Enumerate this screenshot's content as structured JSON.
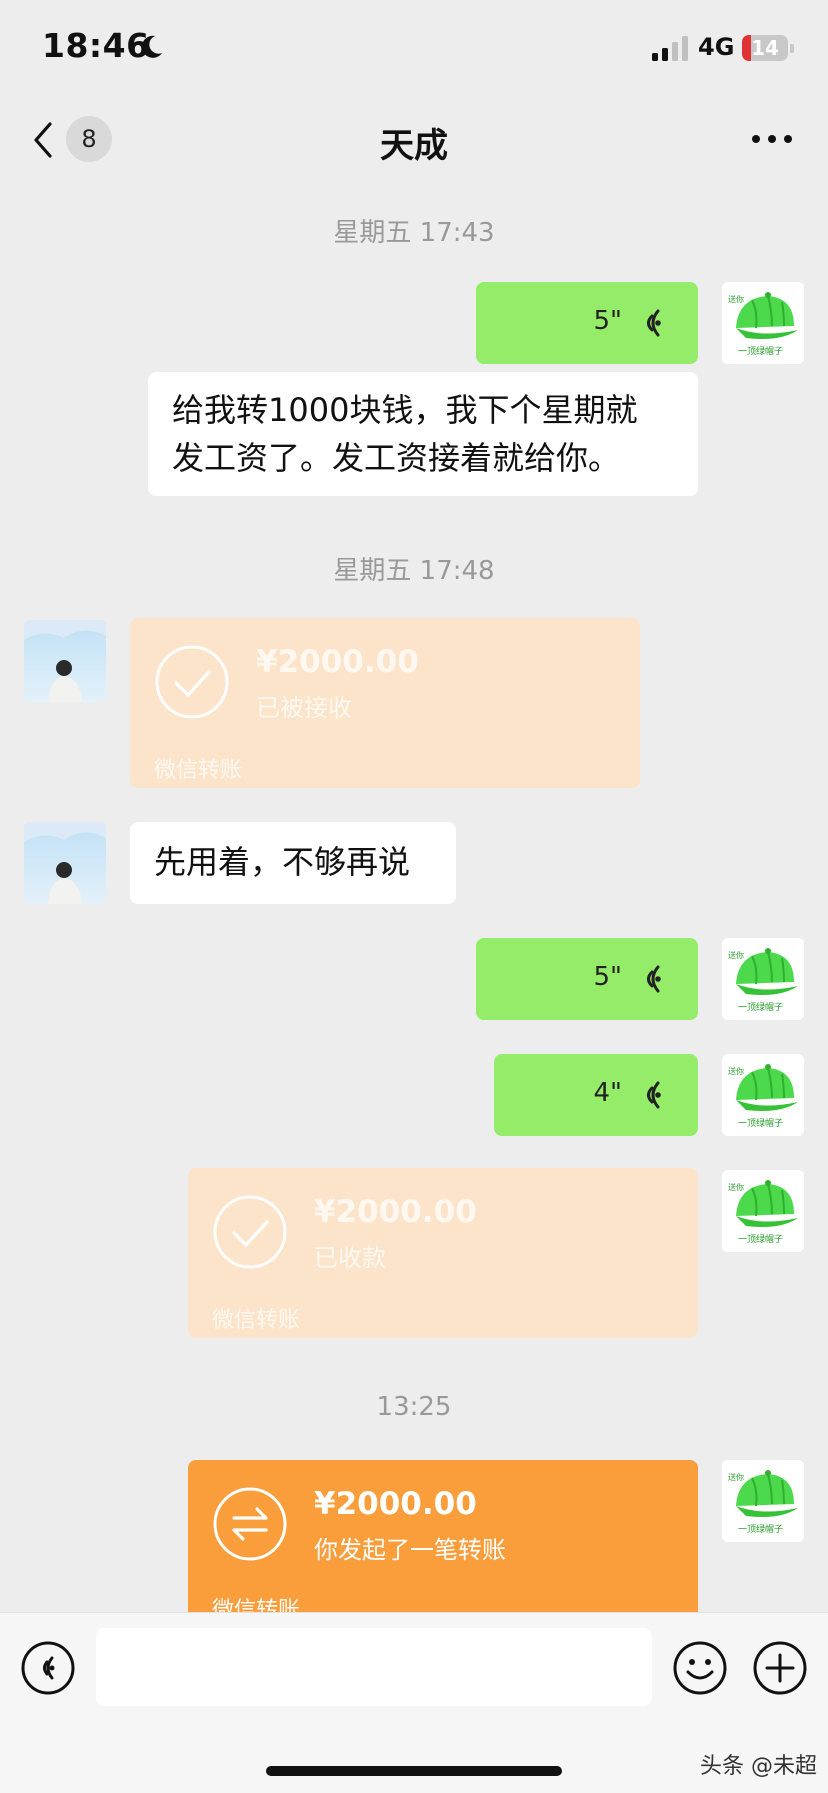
{
  "status_bar": {
    "time": "18:46",
    "network": "4G",
    "battery": "14"
  },
  "nav": {
    "unread_count": "8",
    "title": "天成"
  },
  "timestamps": [
    "星期五 17:43",
    "星期五 17:48",
    "13:25"
  ],
  "hat_sticker": {
    "top_text": "送你",
    "bottom_text": "一顶绿帽子"
  },
  "messages": {
    "voice_1": {
      "duration": "5\""
    },
    "text_1": {
      "line1": "给我转1000块钱，我下个星期就",
      "line2": "发工资了。发工资接着就给你。"
    },
    "transfer_1": {
      "amount": "¥2000.00",
      "status": "已被接收",
      "brand": "微信转账"
    },
    "text_2": {
      "content": "先用着，不够再说"
    },
    "voice_2": {
      "duration": "5\""
    },
    "voice_3": {
      "duration": "4\""
    },
    "transfer_2": {
      "amount": "¥2000.00",
      "status": "已收款",
      "brand": "微信转账"
    },
    "transfer_3": {
      "amount": "¥2000.00",
      "status": "你发起了一笔转账",
      "brand": "微信转账"
    }
  },
  "watermark": "头条 @未超",
  "colors": {
    "voice_bubble": "#95ec69",
    "transfer_active": "#fa9d3b",
    "transfer_done": "#fbe4ca",
    "background": "#ededed"
  }
}
